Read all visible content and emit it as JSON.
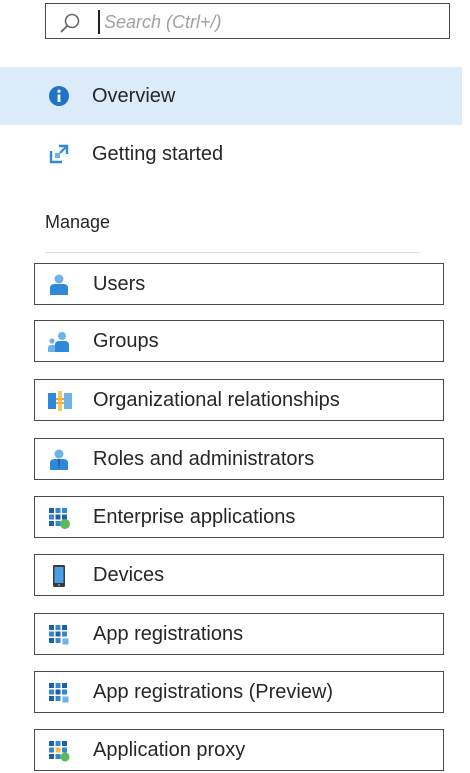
{
  "search": {
    "placeholder": "Search (Ctrl+/)"
  },
  "top_items": [
    {
      "label": "Overview",
      "icon": "info-icon",
      "selected": true
    },
    {
      "label": "Getting started",
      "icon": "quickstart-icon",
      "selected": false
    }
  ],
  "manage": {
    "header": "Manage",
    "items": [
      {
        "label": "Users",
        "icon": "user-icon"
      },
      {
        "label": "Groups",
        "icon": "group-icon"
      },
      {
        "label": "Organizational relationships",
        "icon": "org-relationships-icon"
      },
      {
        "label": "Roles and administrators",
        "icon": "roles-icon"
      },
      {
        "label": "Enterprise applications",
        "icon": "enterprise-apps-icon"
      },
      {
        "label": "Devices",
        "icon": "device-icon"
      },
      {
        "label": "App registrations",
        "icon": "app-registrations-icon"
      },
      {
        "label": "App registrations (Preview)",
        "icon": "app-registrations-preview-icon"
      },
      {
        "label": "Application proxy",
        "icon": "application-proxy-icon"
      }
    ]
  },
  "colors": {
    "accent": "#0078d4",
    "selected_bg": "#dcebfa",
    "icon_blue": "#2e8ad8",
    "icon_light": "#6fb2e8",
    "icon_green": "#5cb85c"
  }
}
